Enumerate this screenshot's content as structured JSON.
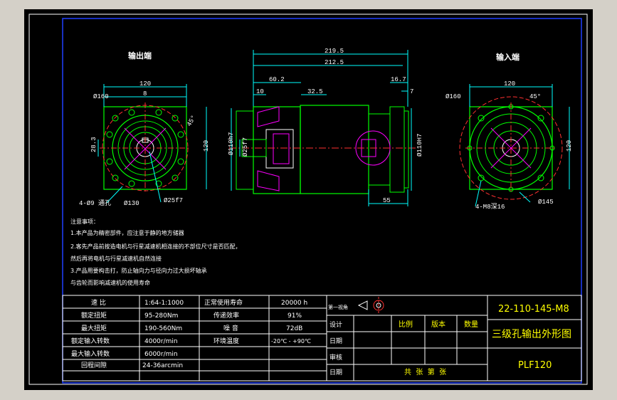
{
  "views": {
    "output_label": "输出端",
    "input_label": "输入端"
  },
  "dimensions": {
    "output": {
      "width": "120",
      "pcd": "Ø160",
      "key_width": "8",
      "key_height": "28.3",
      "angle": "45°",
      "height": "120",
      "holes": "4-Ø9 通孔",
      "spigot": "Ø130",
      "shaft": "Ø25f7"
    },
    "side": {
      "total": "219.5",
      "body": "212.5",
      "flange": "60.2",
      "d1": "10",
      "d2": "32.5",
      "d3": "16.7",
      "d4": "7",
      "left_dia1": "Ø110h7",
      "left_dia2": "Ø25f7",
      "right_dia": "Ø110H7",
      "bottom": "55"
    },
    "input": {
      "width": "120",
      "pcd": "Ø160",
      "angle": "45°",
      "height": "120",
      "holes": "4-M8深16",
      "bolt_circle": "Ø145"
    }
  },
  "notes": [
    "注意事项：",
    "1.本产品为精密部件，应注意于静的地方储器",
    "2.客先产品前按造电机与行星减速机相连接的不部位尺寸是否匹配，",
    "然后再将电机与行星减速机自然连接",
    "3.产品用要构击打，防止轴向力与径向力过大损坏轴承",
    "与齿轮而影响减速机的使用寿命"
  ],
  "spec_table": {
    "rows": [
      {
        "l1": "速 比",
        "v1": "1:64-1:1000",
        "l2": "正常使用寿命",
        "v2": "20000 h"
      },
      {
        "l1": "额定扭矩",
        "v1": "95-280Nm",
        "l2": "传递效率",
        "v2": "91%"
      },
      {
        "l1": "最大扭矩",
        "v1": "190-560Nm",
        "l2": "噪 音",
        "v2": "72dB"
      },
      {
        "l1": "额定输入转数",
        "v1": "4000r/min",
        "l2": "环境温度",
        "v2": "-20℃ - +90℃"
      },
      {
        "l1": "最大输入转数",
        "v1": "6000r/min",
        "l2": "",
        "v2": ""
      },
      {
        "l1": "回程间隙",
        "v1": "24-36arcmin",
        "l2": "",
        "v2": ""
      }
    ]
  },
  "title_block": {
    "projection": "第一视角",
    "rows": [
      "设计",
      "日期",
      "审核",
      "日期"
    ],
    "headers": [
      "比例",
      "版本",
      "数量"
    ],
    "sheets": "共  张  第  张",
    "drawing_no": "22-110-145-M8",
    "title": "三级孔输出外形图",
    "model": "PLF120"
  },
  "colors": {
    "background": "#000000",
    "frame": "#ffffff",
    "border": "#0000ff",
    "outline": "#00ff00",
    "center": "#ff3030",
    "dims": "#00ffff",
    "hatch": "#ff00ff",
    "title": "#ffff00"
  }
}
